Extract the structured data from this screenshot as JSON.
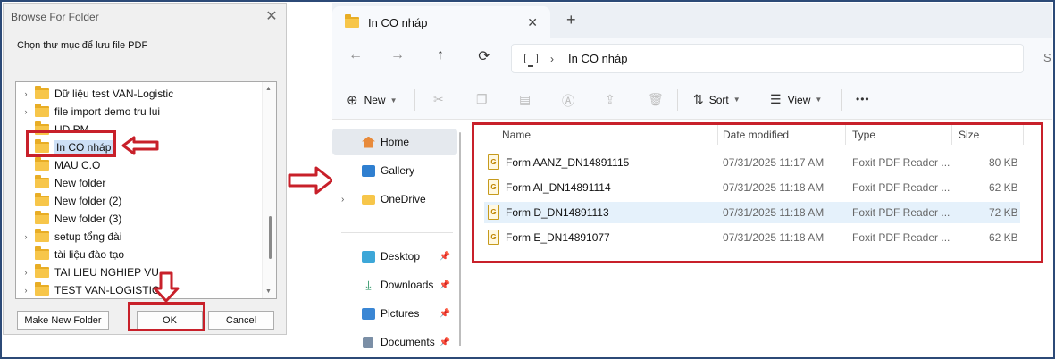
{
  "dialog": {
    "title": "Browse For Folder",
    "close_glyph": "✕",
    "prompt": "Chọn thư mục để lưu file PDF",
    "folders": [
      {
        "label": "Dữ liệu test VAN-Logistic",
        "expander": "›"
      },
      {
        "label": "file import demo tru lui",
        "expander": "›"
      },
      {
        "label": "HD PM",
        "expander": ""
      },
      {
        "label": "In CO nháp",
        "expander": "",
        "selected": true
      },
      {
        "label": "MAU C.O",
        "expander": ""
      },
      {
        "label": "New folder",
        "expander": ""
      },
      {
        "label": "New folder (2)",
        "expander": ""
      },
      {
        "label": "New folder (3)",
        "expander": ""
      },
      {
        "label": "setup tổng đài",
        "expander": "›"
      },
      {
        "label": "tài liệu đào tạo",
        "expander": ""
      },
      {
        "label": "TAI LIEU NGHIEP VU",
        "expander": "›"
      },
      {
        "label": "TEST VAN-LOGISTICS",
        "expander": "›"
      }
    ],
    "buttons": {
      "make_new_folder": "Make New Folder",
      "ok": "OK",
      "cancel": "Cancel"
    }
  },
  "explorer": {
    "tab_title": "In CO nháp",
    "tab_close": "✕",
    "tab_new": "+",
    "nav": {
      "back": "←",
      "forward": "→",
      "up": "↑",
      "refresh": "⟳"
    },
    "address": {
      "chevron": "›",
      "path": "In CO nháp"
    },
    "search_stub": "S",
    "toolbar": {
      "new": "New",
      "sort": "Sort",
      "view": "View",
      "more": "•••"
    },
    "nav_pane": [
      {
        "label": "Home",
        "icon": "home-icon",
        "selected": true
      },
      {
        "label": "Gallery",
        "icon": "gallery-icon"
      },
      {
        "label": "OneDrive",
        "icon": "folder-icon",
        "expander": "›"
      },
      {
        "label": "Desktop",
        "icon": "desktop-icon",
        "pinned": true
      },
      {
        "label": "Downloads",
        "icon": "downloads-icon",
        "pinned": true
      },
      {
        "label": "Pictures",
        "icon": "pictures-icon",
        "pinned": true
      },
      {
        "label": "Documents",
        "icon": "documents-icon",
        "pinned": true
      }
    ],
    "columns": {
      "name": "Name",
      "date": "Date modified",
      "type": "Type",
      "size": "Size"
    },
    "files": [
      {
        "name": "Form AANZ_DN14891115",
        "date": "07/31/2025 11:17 AM",
        "type": "Foxit PDF Reader ...",
        "size": "80 KB"
      },
      {
        "name": "Form AI_DN14891114",
        "date": "07/31/2025 11:18 AM",
        "type": "Foxit PDF Reader ...",
        "size": "62 KB"
      },
      {
        "name": "Form D_DN14891113",
        "date": "07/31/2025 11:18 AM",
        "type": "Foxit PDF Reader ...",
        "size": "72 KB",
        "highlighted": true
      },
      {
        "name": "Form E_DN14891077",
        "date": "07/31/2025 11:18 AM",
        "type": "Foxit PDF Reader ...",
        "size": "62 KB"
      }
    ]
  },
  "colors": {
    "annotation_red": "#c8202a",
    "selection_blue": "#cde0f7",
    "row_highlight": "#e5f1fb",
    "folder_yellow": "#f7c64a"
  }
}
